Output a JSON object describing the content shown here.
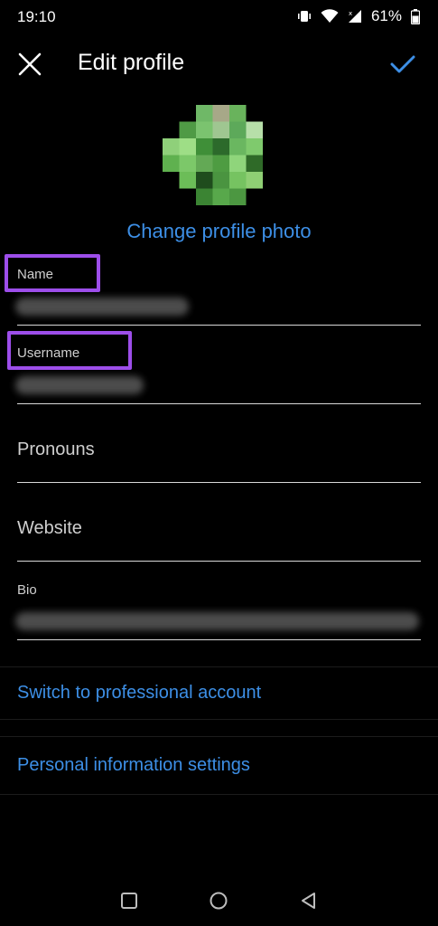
{
  "status": {
    "time": "19:10",
    "battery": "61%",
    "icons": [
      "vibrate-icon",
      "wifi-icon",
      "signal-icon",
      "battery-icon"
    ]
  },
  "header": {
    "title": "Edit profile",
    "close_icon": "close-icon",
    "confirm_icon": "checkmark-icon"
  },
  "avatar": {
    "change_photo_label": "Change profile photo"
  },
  "fields": {
    "name": {
      "label": "Name"
    },
    "username": {
      "label": "Username"
    },
    "pronouns": {
      "placeholder": "Pronouns"
    },
    "website": {
      "placeholder": "Website"
    },
    "bio": {
      "label": "Bio"
    }
  },
  "links": {
    "professional": "Switch to professional account",
    "personal_info": "Personal information settings"
  },
  "nav": {
    "icons": [
      "recents-icon",
      "home-icon",
      "back-icon"
    ]
  },
  "colors": {
    "accent": "#3d8fe6",
    "highlight": "#9d4eea",
    "background": "#000000"
  }
}
